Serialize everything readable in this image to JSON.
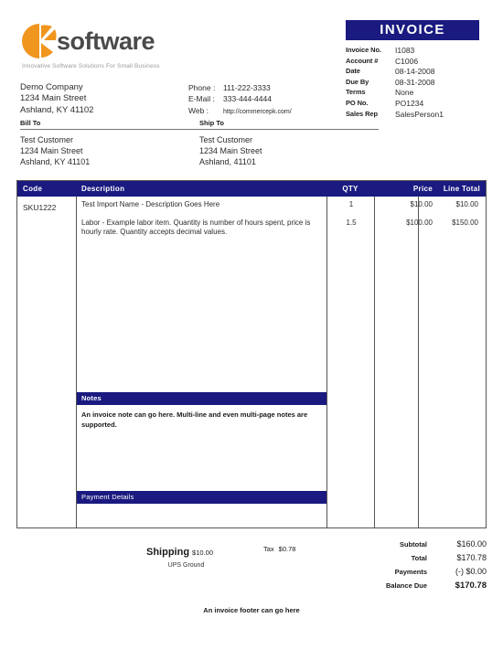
{
  "brand": {
    "logo_icon": "k-circle-logo",
    "wordmark": "software",
    "tagline": "Innovative Software Solutions For Small Business",
    "accent_color": "#f0961e",
    "theme_color": "#1a1a80"
  },
  "company": {
    "name": "Demo Company",
    "street": "1234 Main Street",
    "city_state_zip": "Ashland, KY 41102"
  },
  "contact": {
    "phone_label": "Phone :",
    "phone_value": "111-222-3333",
    "email_label": "E-Mail :",
    "email_value": "333-444-4444",
    "web_label": "Web :",
    "web_value": "http://commercepk.com/"
  },
  "document": {
    "title": "INVOICE",
    "fields": [
      {
        "label": "Invoice No.",
        "value": "I1083"
      },
      {
        "label": "Account #",
        "value": "C1006"
      },
      {
        "label": "Date",
        "value": "08-14-2008"
      },
      {
        "label": "Due By",
        "value": "08-31-2008"
      },
      {
        "label": "Terms",
        "value": "None"
      },
      {
        "label": "PO No.",
        "value": "PO1234"
      },
      {
        "label": "Sales Rep",
        "value": "SalesPerson1"
      }
    ]
  },
  "bill_to": {
    "heading": "Bill To",
    "name": "Test Customer",
    "street": "1234 Main Street",
    "city_state_zip": "Ashland, KY 41101"
  },
  "ship_to": {
    "heading": "Ship To",
    "name": "Test Customer",
    "street": "1234 Main Street",
    "city_state_zip": "Ashland,  41101"
  },
  "items": {
    "columns": {
      "code": "Code",
      "description": "Description",
      "qty": "QTY",
      "price": "Price",
      "line_total": "Line Total"
    },
    "code_value": "SKU1222",
    "rows": [
      {
        "description": "Test Import Name - Description Goes Here",
        "qty": "1",
        "price": "$10.00",
        "line_total": "$10.00"
      },
      {
        "description": "Labor - Example labor item. Quantity is number of hours spent, price is hourly rate. Quantity accepts decimal values.",
        "qty": "1.5",
        "price": "$100.00",
        "line_total": "$150.00"
      }
    ]
  },
  "notes": {
    "heading": "Notes",
    "body": "An invoice note can go here. Multi-line and even multi-page notes are supported."
  },
  "payment_details": {
    "heading": "Payment Details"
  },
  "shipping": {
    "label": "Shipping",
    "amount": "$10.00",
    "method": "UPS Ground"
  },
  "tax": {
    "label": "Tax",
    "amount": "$0.78"
  },
  "totals": [
    {
      "label": "Subtotal",
      "value": "$160.00",
      "emphasis": false
    },
    {
      "label": "Total",
      "value": "$170.78",
      "emphasis": false
    },
    {
      "label": "Payments",
      "value": "(-) $0.00",
      "emphasis": false
    },
    {
      "label": "Balance Due",
      "value": "$170.78",
      "emphasis": true
    }
  ],
  "footer": {
    "text": "An invoice footer can go here"
  }
}
